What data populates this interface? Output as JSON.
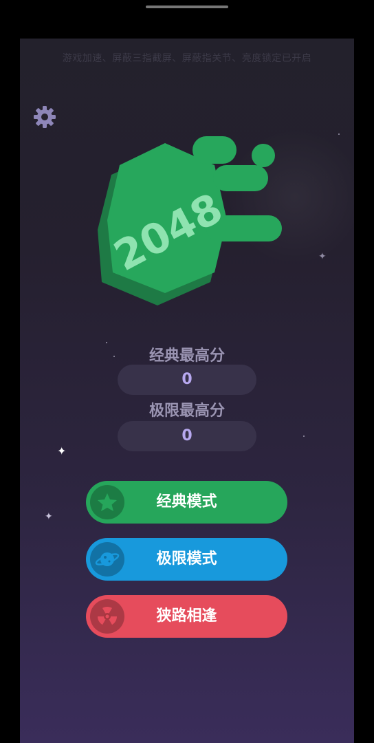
{
  "notice": "游戏加速、屏蔽三指截屏、屏蔽指关节、亮度锁定已开启",
  "logo": {
    "text": "2048"
  },
  "scores": {
    "classic_label": "经典最高分",
    "classic_value": "0",
    "limit_label": "极限最高分",
    "limit_value": "0"
  },
  "modes": {
    "classic": "经典模式",
    "limit": "极限模式",
    "narrow": "狭路相逢"
  },
  "colors": {
    "classic": "#26a65b",
    "limit": "#1899dc",
    "narrow": "#e64c5c",
    "logo_green": "#27a75c"
  },
  "icons": {
    "settings": "gear-icon",
    "classic": "star-icon",
    "limit": "planet-icon",
    "narrow": "radiation-icon"
  }
}
